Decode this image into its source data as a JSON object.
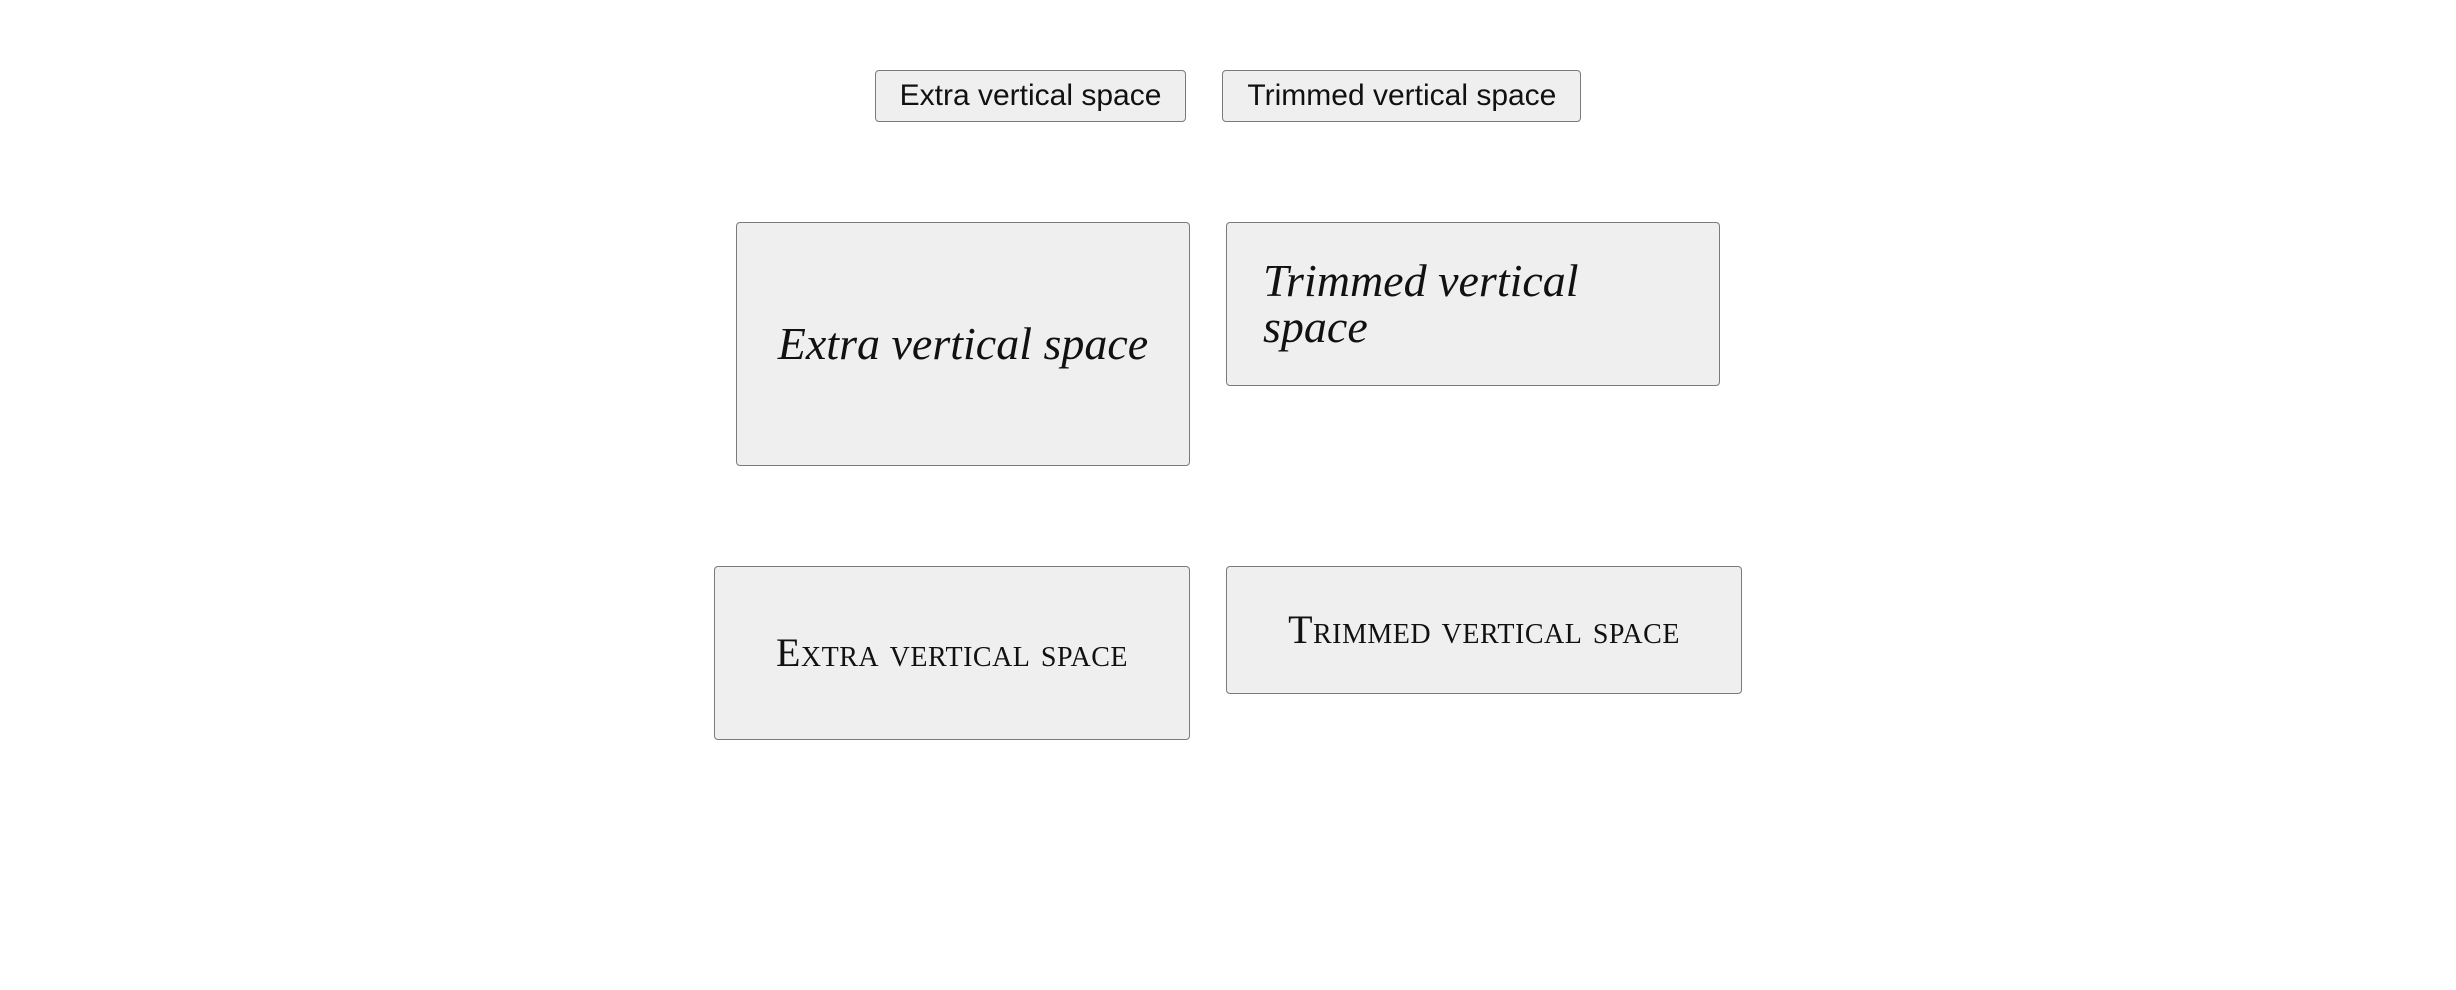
{
  "rows": [
    {
      "kind": "system",
      "extra": "Extra vertical space",
      "trimmed": "Trimmed vertical space"
    },
    {
      "kind": "script",
      "extra": "Extra vertical space",
      "trimmed": "Trimmed vertical space"
    },
    {
      "kind": "hand-smallcaps",
      "extra": "Extra vertical space",
      "trimmed": "Trimmed vertical space"
    }
  ]
}
